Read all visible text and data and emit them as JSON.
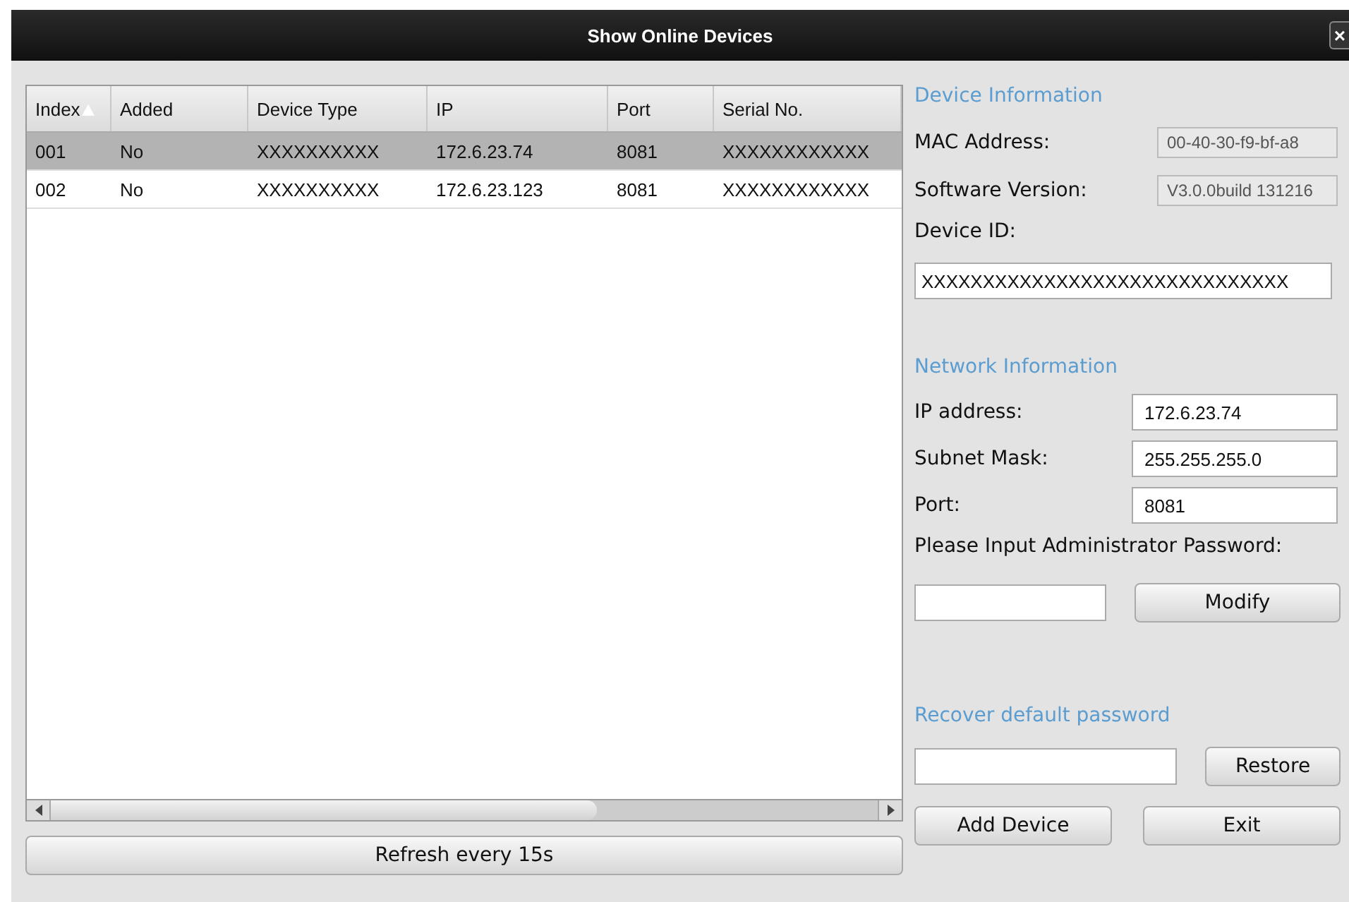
{
  "window": {
    "title": "Show Online Devices",
    "close": "×"
  },
  "table": {
    "columns": [
      {
        "label": "Index",
        "sorted": true
      },
      {
        "label": "Added",
        "sorted": false
      },
      {
        "label": "Device Type",
        "sorted": false
      },
      {
        "label": "IP",
        "sorted": false
      },
      {
        "label": "Port",
        "sorted": false
      },
      {
        "label": "Serial No.",
        "sorted": false
      }
    ],
    "rows": [
      {
        "cells": [
          "001",
          "No",
          "XXXXXXXXXX",
          "172.6.23.74",
          "8081",
          "XXXXXXXXXXXX"
        ],
        "selected": true
      },
      {
        "cells": [
          "002",
          "No",
          "XXXXXXXXXX",
          "172.6.23.123",
          "8081",
          "XXXXXXXXXXXX"
        ],
        "selected": false
      }
    ]
  },
  "refresh_button": "Refresh every 15s",
  "device_information": {
    "heading": "Device Information",
    "mac_label": "MAC Address:",
    "mac": "00-40-30-f9-bf-a8",
    "software_label": "Software Version:",
    "software": "V3.0.0build 131216",
    "id_label": "Device ID:",
    "id": "XXXXXXXXXXXXXXXXXXXXXXXXXXXXXX"
  },
  "network_information": {
    "heading": "Network Information",
    "fields": [
      {
        "label": "IP address:",
        "value": "172.6.23.74"
      },
      {
        "label": "Subnet Mask:",
        "value": "255.255.255.0"
      },
      {
        "label": "Port:",
        "value": "8081"
      }
    ],
    "password_label": "Please Input Administrator Password:",
    "modify_button": "Modify"
  },
  "recover": {
    "heading": "Recover default password",
    "restore_button": "Restore"
  },
  "buttons": [
    "Add Device",
    "Exit"
  ]
}
